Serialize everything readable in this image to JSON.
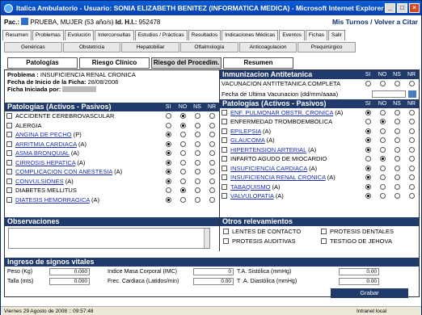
{
  "window": {
    "title": "Italica Ambulatorio - Usuario: SONIA ELIZABETH BENITEZ (INFORMATICA MEDICA) - Microsoft Internet Explorer"
  },
  "patient": {
    "label": "Pac.:",
    "name": "PRUEBA, MUJER (53 año/s)",
    "id_label": "Id. H.I.:",
    "id": "952478",
    "links": "Mis Turnos / Volver a Citar"
  },
  "tabs1": [
    "Resumen",
    "Problemas",
    "Evolución",
    "Interconsultas",
    "Estudios / Prácticas",
    "Resultados",
    "Indicaciones Médicas",
    "Eventos",
    "Fichas",
    "Salir"
  ],
  "tabs2": [
    "Genéricas",
    "Obstetricia",
    "Hepatobiliar",
    "Oftalmología",
    "Anticoagulacion",
    "Prequirúrgico"
  ],
  "tabs3": [
    "Patologías",
    "Riesgo Clínico",
    "Riesgo del Procedim.",
    "Resumen"
  ],
  "problem": {
    "label": "Problema :",
    "value": "INSUFICIENCIA RENAL CRONICA",
    "fecha_label": "Fecha de Inicio de la Ficha:",
    "fecha": "28/08/2008",
    "iniciada_label": "Ficha Iniciada por:"
  },
  "cols": [
    "SI",
    "NO",
    "NS",
    "NR"
  ],
  "left_header": "Patologías (Activos - Pasivos)",
  "left_items": [
    {
      "label": "ACCIDENTE CEREBROVASCULAR",
      "link": false,
      "sel": 1
    },
    {
      "label": "ALERGIA",
      "link": false,
      "sel": 1
    },
    {
      "label": "ANGINA DE PECHO",
      "suffix": " (P)",
      "link": true,
      "sel": 0
    },
    {
      "label": "ARRITMIA CARDIACA",
      "suffix": " (A)",
      "link": true,
      "sel": 0
    },
    {
      "label": "ASMA BRONQUIAL",
      "suffix": " (A)",
      "link": true,
      "sel": 0
    },
    {
      "label": "CIRROSIS HEPATICA",
      "suffix": " (A)",
      "link": true,
      "sel": 0
    },
    {
      "label": "COMPLICACION CON ANESTESIA",
      "suffix": " (A)",
      "link": true,
      "sel": 0
    },
    {
      "label": "CONVULSIONES",
      "suffix": " (A)",
      "link": true,
      "sel": 0
    },
    {
      "label": "DIABETES MELLITUS",
      "link": false,
      "sel": 1
    },
    {
      "label": "DIATESIS HEMORRAGICA",
      "suffix": " (A)",
      "link": true,
      "sel": 0
    }
  ],
  "inmun": {
    "header": "Inmunizacion Antitetanica",
    "vac": "VACUNACION ANTITETANICA COMPLETA",
    "fecha": "Fecha de Ultima Vacunacion (dd/mm/aaaa)"
  },
  "right_header": "Patologías (Activos - Pasivos)",
  "right_items": [
    {
      "label": "ENF. PULMONAR OBSTR. CRONICA",
      "suffix": " (A)",
      "link": true,
      "sel": 0
    },
    {
      "label": "ENFERMEDAD TROMBOEMBOLICA",
      "link": false,
      "sel": 1
    },
    {
      "label": "EPILEPSIA",
      "suffix": " (A)",
      "link": true,
      "sel": 0
    },
    {
      "label": "GLAUCOMA",
      "suffix": " (A)",
      "link": true,
      "sel": 0
    },
    {
      "label": "HIPERTENSION ARTERIAL",
      "suffix": " (A)",
      "link": true,
      "sel": 0
    },
    {
      "label": "INFARTO AGUDO DE MIOCARDIO",
      "link": false,
      "sel": 1
    },
    {
      "label": "INSUFICIENCIA CARDIACA",
      "suffix": " (A)",
      "link": true,
      "sel": 0
    },
    {
      "label": "INSUFICIENCIA RENAL CRONICA",
      "suffix": " (A)",
      "link": true,
      "sel": 0
    },
    {
      "label": "TABAQUISMO",
      "suffix": " (A)",
      "link": true,
      "sel": 0
    },
    {
      "label": "VALVULOPATIA",
      "suffix": " (A)",
      "link": true,
      "sel": 0
    }
  ],
  "obs": {
    "header": "Observaciones"
  },
  "otros": {
    "header": "Otros relevamientos",
    "items": [
      "LENTES DE CONTACTO",
      "PROTESIS DENTALES",
      "PROTESIS AUDITIVAS",
      "TESTIGO DE JEHOVA"
    ]
  },
  "vitales": {
    "header": "Ingreso de signos vitales",
    "peso": "Peso (Kg)",
    "talla": "Talla (mts)",
    "imc": "Indice Masa Corporal (IMC)",
    "fc": "Frec. Cardiaca (Latidos/min)",
    "tas": "T.A. Sistólica (mmHg)",
    "tad": "T .A. Diastólica (mmHg)",
    "peso_v": "0.000",
    "talla_v": "0.000",
    "imc_v": "0",
    "fc_v": "0.00",
    "tas_v": "0.00",
    "tad_v": "0.00"
  },
  "grabar": "Grabar",
  "status": {
    "text": "Viernes 29 Agosto de 2008 :: 09:57:48",
    "zone": "Intranet local"
  }
}
